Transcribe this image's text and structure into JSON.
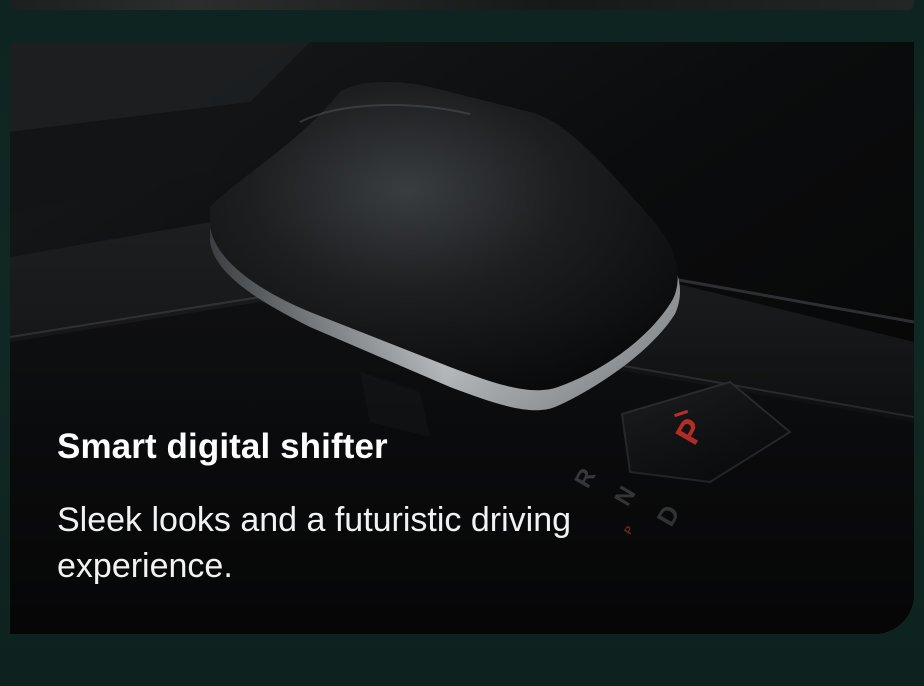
{
  "card": {
    "image_subject": "gear-shifter-image",
    "title": "Smart digital shifter",
    "description": "Sleek looks and a futuristic driving experience.",
    "gear_labels": {
      "park": "P",
      "reverse": "R",
      "neutral": "N",
      "drive": "D"
    }
  },
  "colors": {
    "page_background": "#0f2420",
    "card_background": "#050606",
    "title_text": "#ffffff",
    "description_text": "#f2f2f2",
    "park_indicator": "#e0392f"
  }
}
